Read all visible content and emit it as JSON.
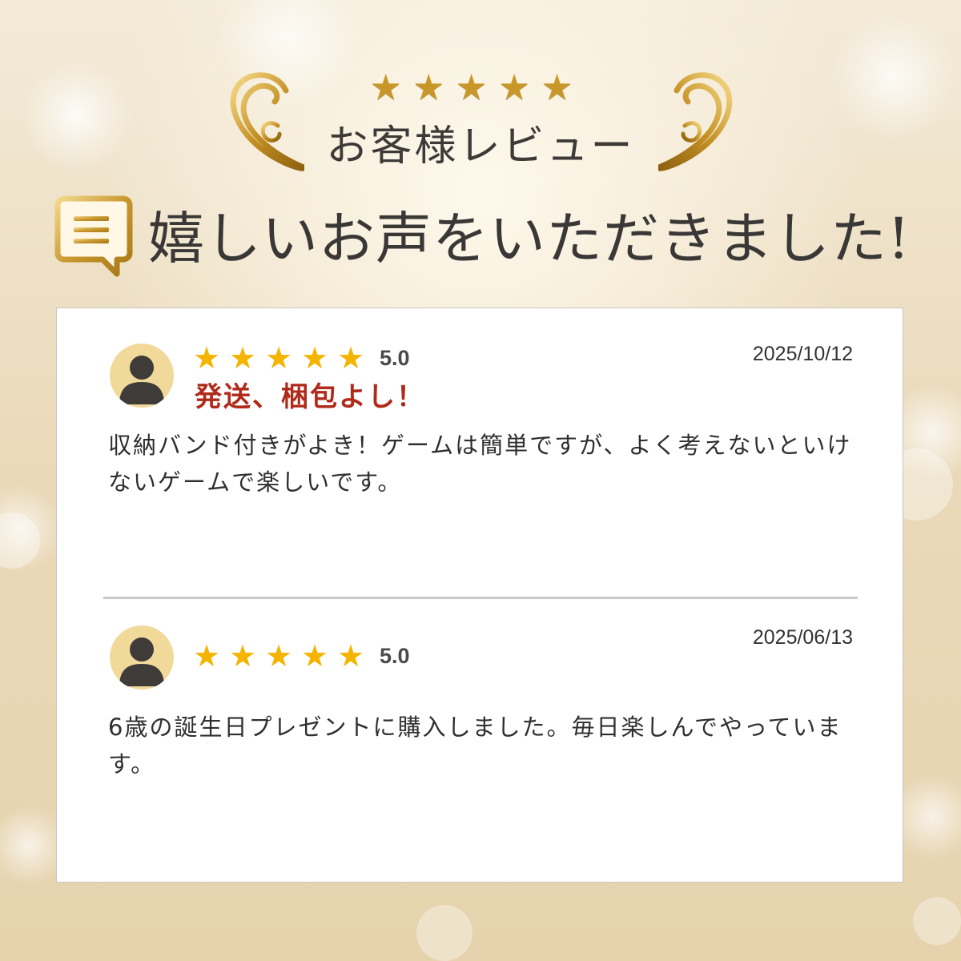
{
  "header": {
    "top_stars": [
      "★",
      "★",
      "★",
      "★",
      "★"
    ],
    "subtitle": "お客様レビュー",
    "title": "嬉しいお声をいただきました!"
  },
  "colors": {
    "gold": "#c9962a",
    "star": "#f4b400",
    "accent_red": "#b02a1a",
    "avatar_bg": "#f1d99a",
    "avatar_fg": "#3e3b38"
  },
  "icons": {
    "chat": "chat-bubble-icon",
    "user": "user-avatar-icon",
    "swirl": "ornament-swirl-icon"
  },
  "reviews": [
    {
      "stars": [
        "★",
        "★",
        "★",
        "★",
        "★"
      ],
      "score": "5.0",
      "date": "2025/10/12",
      "title": "発送、梱包よし！",
      "body": "収納バンド付きがよき！ゲームは簡単ですが、よく考えないといけないゲームで楽しいです。"
    },
    {
      "stars": [
        "★",
        "★",
        "★",
        "★",
        "★"
      ],
      "score": "5.0",
      "date": "2025/06/13",
      "title": "",
      "body": "6歳の誕生日プレゼントに購入しました。毎日楽しんでやっています。"
    }
  ]
}
